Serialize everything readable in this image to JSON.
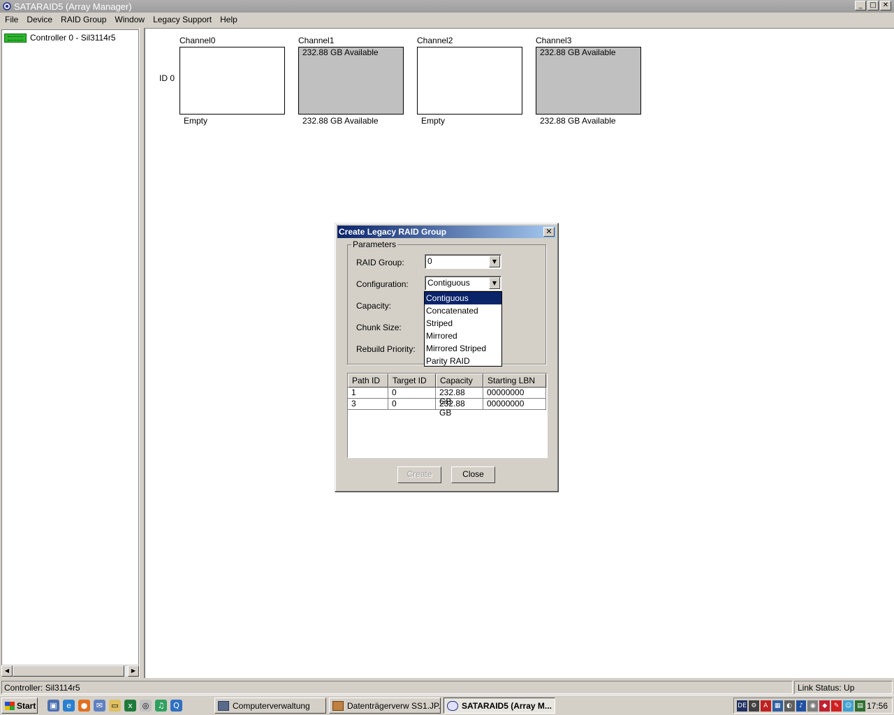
{
  "window": {
    "title": "SATARAID5 (Array Manager)",
    "buttons": {
      "minimize": "_",
      "maximize": "□",
      "close": "✕"
    }
  },
  "menubar": [
    "File",
    "Device",
    "RAID Group",
    "Window",
    "Legacy Support",
    "Help"
  ],
  "tree": {
    "controller": "Controller 0 - Sil3114r5"
  },
  "channels": {
    "row_label": "ID 0",
    "items": [
      {
        "name": "Channel0",
        "box_text": "",
        "below": "Empty",
        "filled": false
      },
      {
        "name": "Channel1",
        "box_text": "232.88 GB Available",
        "below": "232.88 GB Available",
        "filled": true
      },
      {
        "name": "Channel2",
        "box_text": "",
        "below": "Empty",
        "filled": false
      },
      {
        "name": "Channel3",
        "box_text": "232.88 GB Available",
        "below": "232.88 GB Available",
        "filled": true
      }
    ]
  },
  "dialog": {
    "title": "Create Legacy RAID Group",
    "group_label": "Parameters",
    "labels": {
      "raid_group": "RAID Group:",
      "configuration": "Configuration:",
      "capacity": "Capacity:",
      "chunk_size": "Chunk Size:",
      "rebuild_priority": "Rebuild Priority:"
    },
    "raid_group_value": "0",
    "configuration_value": "Contiguous",
    "dropdown_options": [
      "Contiguous",
      "Concatenated",
      "Striped",
      "Mirrored",
      "Mirrored Striped",
      "Parity RAID"
    ],
    "selected_option": "Contiguous",
    "table": {
      "headers": [
        "Path ID",
        "Target ID",
        "Capacity",
        "Starting LBN"
      ],
      "rows": [
        [
          "1",
          "0",
          "232.88 GB",
          "00000000"
        ],
        [
          "3",
          "0",
          "232.88 GB",
          "00000000"
        ]
      ]
    },
    "create_label": "Create",
    "close_label": "Close",
    "x": "✕"
  },
  "status": {
    "left": "Controller: Sil3114r5",
    "right": "Link Status: Up"
  },
  "taskbar": {
    "start": "Start",
    "buttons": [
      "Computerverwaltung",
      "Datenträgerverw SS1.JP...",
      "SATARAID5 (Array M..."
    ],
    "active_index": 2,
    "lang": "DE",
    "clock": "17:56"
  },
  "colors": {
    "selection": "#0a246a",
    "title_gradient_end": "#a6caf0",
    "controller_icon": "#2fb52f",
    "disk_available": "#c0c0c0"
  }
}
